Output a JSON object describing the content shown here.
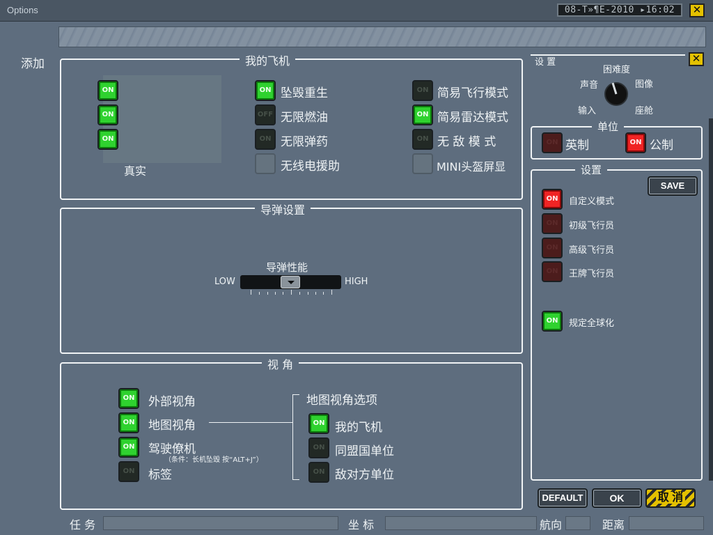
{
  "window": {
    "title": "Options",
    "datetime": "08-T»¶E-2010 ▸16:02",
    "close_glyph": "✕"
  },
  "left_label": "添加",
  "my_aircraft": {
    "title": "我的飞机",
    "left_toggle_labels": [
      "ON",
      "ON",
      "ON"
    ],
    "left_caption": "真实",
    "col2": [
      {
        "label": "坠毁重生",
        "state": "ON"
      },
      {
        "label": "无限燃油",
        "state": "OFF"
      },
      {
        "label": "无限弹药",
        "state": "ON"
      },
      {
        "label": "无线电援助",
        "state": ""
      }
    ],
    "col3": [
      {
        "label": "简易飞行模式",
        "state": "ON"
      },
      {
        "label": "简易雷达模式",
        "state": "ON"
      },
      {
        "label": "无 敌 模 式",
        "state": "ON"
      },
      {
        "label": "MINI头盔屏显",
        "state": ""
      }
    ]
  },
  "missile": {
    "title": "导弹设置",
    "label": "导弹性能",
    "low": "LOW",
    "high": "HIGH",
    "level": 0.5
  },
  "view": {
    "title": "视  角",
    "items": [
      {
        "label": "外部视角",
        "state": "ON"
      },
      {
        "label": "地图视角",
        "state": "ON"
      },
      {
        "label": "驾驶僚机",
        "state": "ON"
      },
      {
        "label": "标签",
        "state": "ON"
      }
    ],
    "note": "（条件：长机坠毁 按“ALT+J”）",
    "map_options_title": "地图视角选项",
    "map_options": [
      {
        "label": "我的飞机",
        "state": "ON"
      },
      {
        "label": "同盟国单位",
        "state": "ON"
      },
      {
        "label": "敌对方单位",
        "state": "ON"
      }
    ]
  },
  "settings": {
    "title": "设 置",
    "dial_labels": {
      "top": "困难度",
      "left": "声音",
      "right": "图像",
      "bottom_left": "输入",
      "bottom_right": "座舱"
    },
    "units_title": "单位",
    "units": [
      {
        "label": "英制",
        "state": "ON"
      },
      {
        "label": "公制",
        "state": "ON"
      }
    ],
    "config_title": "设置",
    "save_label": "SAVE",
    "modes": [
      {
        "label": "自定义模式",
        "state": "ON"
      },
      {
        "label": "初级飞行员",
        "state": "ON"
      },
      {
        "label": "高级飞行员",
        "state": "ON"
      },
      {
        "label": "王牌飞行员",
        "state": "ON"
      }
    ],
    "globalize": {
      "label": "规定全球化",
      "state": "ON"
    }
  },
  "buttons": {
    "default": "DEFAULT",
    "ok": "OK",
    "cancel": "取 消"
  },
  "status_bar": {
    "task": "任 务",
    "coord": "坐 标",
    "heading": "航向",
    "distance": "距离"
  },
  "colors": {
    "on": "#2fd22f",
    "red_on": "#f02424",
    "accent": "#e4c100",
    "bg": "#5e6d7e"
  }
}
